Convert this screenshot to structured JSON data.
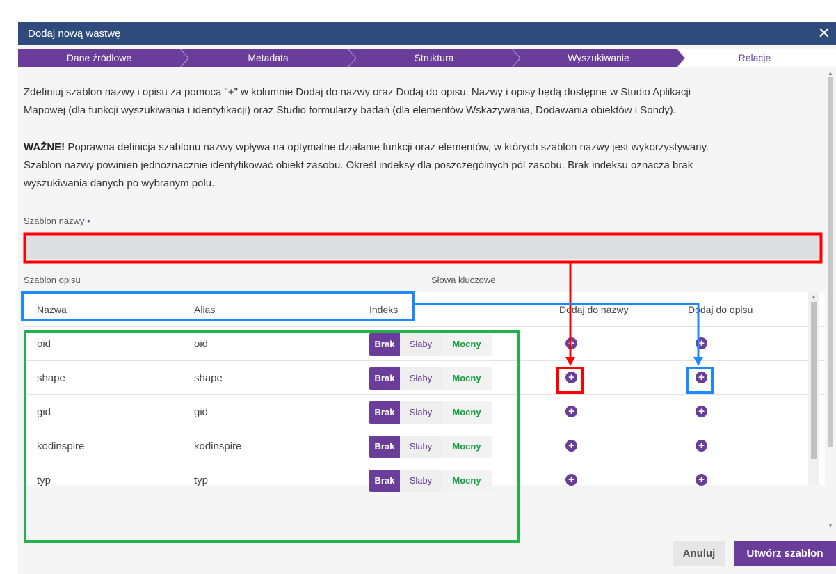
{
  "dialog": {
    "title": "Dodaj nową wastwę",
    "close_icon": "✕"
  },
  "steps": [
    {
      "label": "Dane źródłowe",
      "state": "done"
    },
    {
      "label": "Metadata",
      "state": "done"
    },
    {
      "label": "Struktura",
      "state": "done"
    },
    {
      "label": "Wyszukiwanie",
      "state": "done"
    },
    {
      "label": "Relacje",
      "state": "active"
    }
  ],
  "intro": {
    "line1": "Zdefiniuj szablon nazwy i opisu za pomocą \"+\" w kolumnie Dodaj do nazwy oraz Dodaj do opisu. Nazwy i opisy będą dostępne w Studio Aplikacji",
    "line2": "Mapowej (dla funkcji wyszukiwania i identyfikacji) oraz Studio formularzy badań (dla elementów Wskazywania, Dodawania obiektów i Sondy).",
    "important_label": "WAŻNE!",
    "important_line1": " Poprawna definicja szablonu nazwy wpływa na optymalne działanie funkcji oraz elementów, w których szablon nazwy jest wykorzystywany.",
    "important_line2": "Szablon nazwy powinien jednoznacznie identyfikować obiekt zasobu. Określ indeksy dla poszczególnych pól zasobu. Brak indeksu oznacza brak",
    "important_line3": "wyszukiwania danych po wybranym polu."
  },
  "form": {
    "name_template_label": "Szablon nazwy",
    "required_mark": "•",
    "description_template_label": "Szablon opisu",
    "keywords_label": "Słowa kluczowe",
    "name_template_value": "",
    "description_template_value": "",
    "keywords_value": ""
  },
  "table": {
    "headers": {
      "name": "Nazwa",
      "alias": "Alias",
      "index": "Indeks",
      "add_to_name": "Dodaj do nazwy",
      "add_to_description": "Dodaj do opisu"
    },
    "index_options": {
      "none": "Brak",
      "weak": "Słaby",
      "strong": "Mocny"
    },
    "rows": [
      {
        "name": "oid",
        "alias": "oid",
        "index": "Brak"
      },
      {
        "name": "shape",
        "alias": "shape",
        "index": "Brak"
      },
      {
        "name": "gid",
        "alias": "gid",
        "index": "Brak"
      },
      {
        "name": "kodinspire",
        "alias": "kodinspire",
        "index": "Brak"
      },
      {
        "name": "typ",
        "alias": "typ",
        "index": "Brak"
      }
    ],
    "plus_icon": "+"
  },
  "footer": {
    "cancel_label": "Anuluj",
    "create_label": "Utwórz szablon"
  },
  "colors": {
    "header_bg": "#2f4a7d",
    "accent": "#6a3d9a",
    "strong_green": "#0f9f3a",
    "annotation_red": "#ff0000",
    "annotation_blue": "#1e88ff",
    "annotation_green": "#22b14c"
  }
}
